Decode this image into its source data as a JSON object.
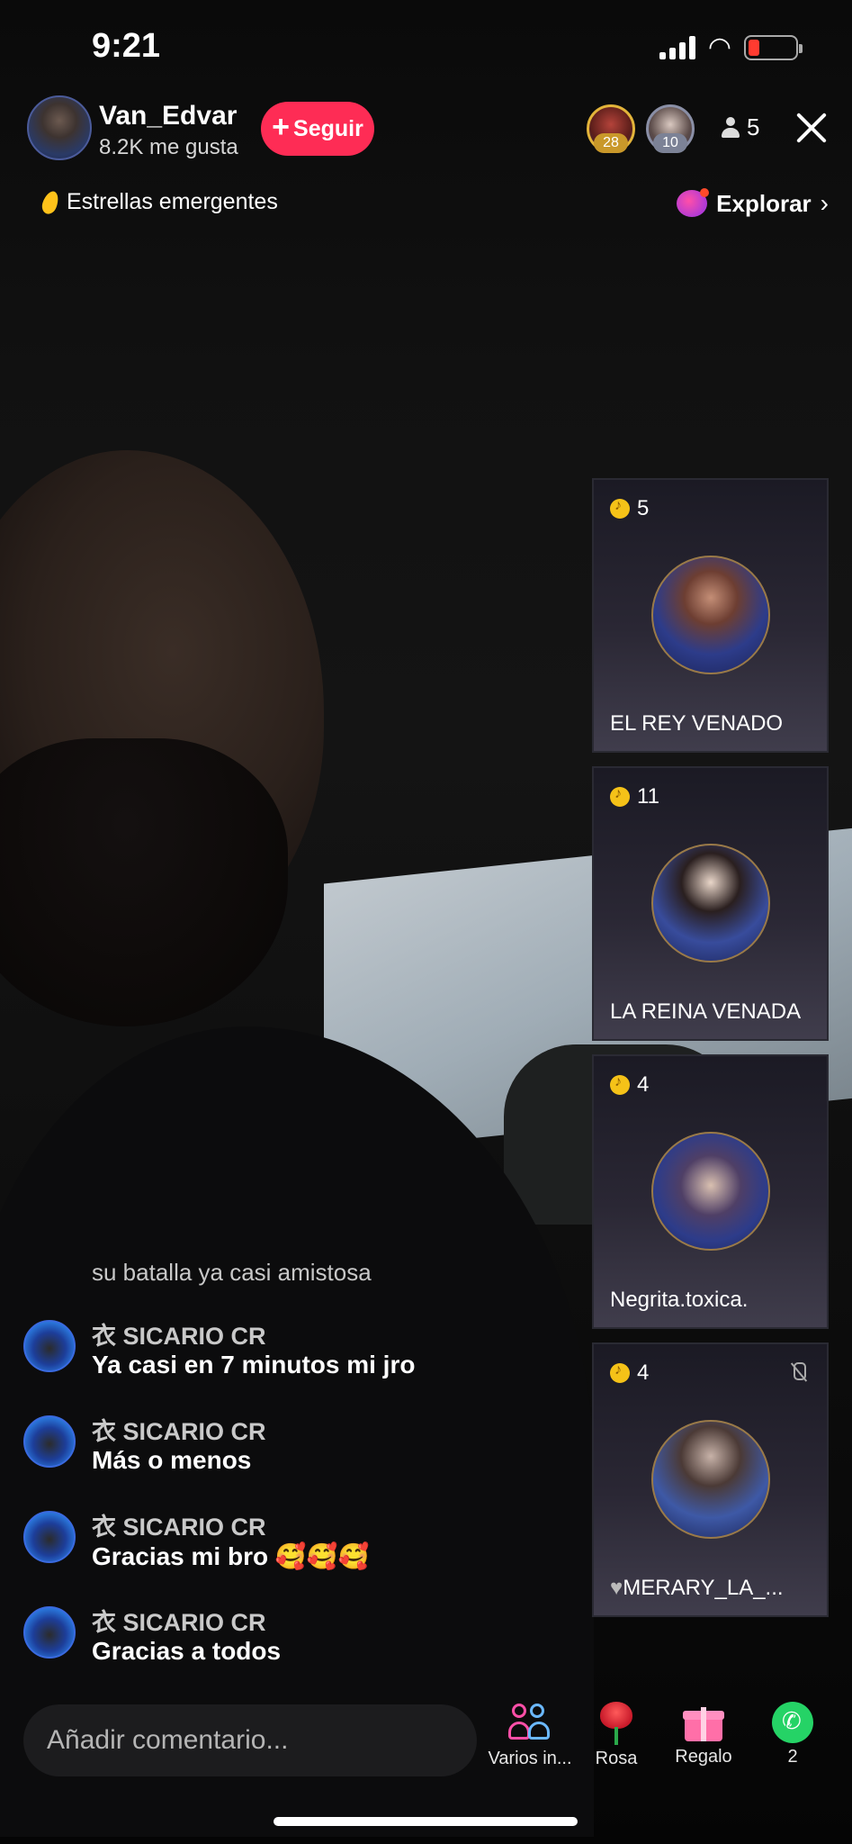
{
  "status": {
    "time": "9:21"
  },
  "host": {
    "name": "Van_Edvar",
    "likes": "8.2K me gusta",
    "follow_label": "Seguir"
  },
  "viewers": {
    "top1_level": "28",
    "top2_level": "10",
    "count": "5"
  },
  "tags": {
    "rising_label": "Estrellas emergentes",
    "explore_label": "Explorar"
  },
  "guests": [
    {
      "score": "5",
      "name": "EL REY VENADO",
      "muted": false
    },
    {
      "score": "11",
      "name": "LA REINA VENADA",
      "muted": false
    },
    {
      "score": "4",
      "name": "Negrita.toxica.",
      "muted": false
    },
    {
      "score": "4",
      "name": "MERARY_LA_...",
      "muted": true
    }
  ],
  "chat": {
    "system_message": "su batalla ya casi amistosa",
    "messages": [
      {
        "user": "衣 SICARIO CR",
        "text": "Ya casi en 7 minutos mi jro"
      },
      {
        "user": "衣 SICARIO CR",
        "text": "Más o menos"
      },
      {
        "user": "衣 SICARIO CR",
        "text": "Gracias mi bro 🥰🥰🥰"
      },
      {
        "user": "衣 SICARIO CR",
        "text": "Gracias a todos"
      }
    ]
  },
  "bottom": {
    "comment_placeholder": "Añadir comentario...",
    "actions": [
      {
        "icon": "multi-guest-icon",
        "label": "Varios in..."
      },
      {
        "icon": "rose-icon",
        "label": "Rosa"
      },
      {
        "icon": "gift-icon",
        "label": "Regalo"
      },
      {
        "icon": "whatsapp-icon",
        "label": "2"
      }
    ]
  },
  "colors": {
    "follow": "#fe2c55",
    "coin": "#f5c218",
    "battery_low": "#ff3b30",
    "whatsapp": "#25d366"
  }
}
